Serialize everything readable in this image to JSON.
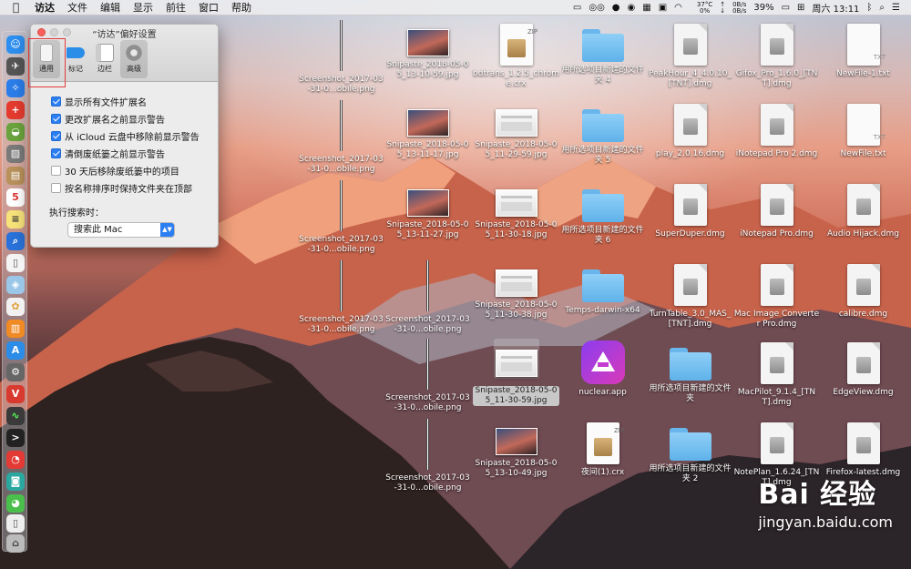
{
  "menubar": {
    "app_name": "访达",
    "items": [
      "文件",
      "编辑",
      "显示",
      "前往",
      "窗口",
      "帮助"
    ],
    "status": {
      "temp": "37°C",
      "temp_sub": "0%",
      "net_up": "0B/s",
      "net_down": "0B/s",
      "battery": "39%",
      "clock": "周六 13:11"
    }
  },
  "window": {
    "title": "“访达”偏好设置",
    "tabs": [
      {
        "label": "通用",
        "icon": "general-switch-icon",
        "active": true
      },
      {
        "label": "标记",
        "icon": "tag-icon",
        "active": false
      },
      {
        "label": "边栏",
        "icon": "sidebar-icon",
        "active": false
      },
      {
        "label": "高级",
        "icon": "gear-icon",
        "active": false
      }
    ],
    "options": [
      {
        "label": "显示所有文件扩展名",
        "checked": true
      },
      {
        "label": "更改扩展名之前显示警告",
        "checked": true
      },
      {
        "label": "从 iCloud 云盘中移除前显示警告",
        "checked": true
      },
      {
        "label": "清倒废纸篓之前显示警告",
        "checked": true
      },
      {
        "label": "30 天后移除废纸篓中的项目",
        "checked": false
      },
      {
        "label": "按名称排序时保持文件夹在顶部",
        "checked": false
      }
    ],
    "search_label": "执行搜索时：",
    "search_value": "搜索此 Mac"
  },
  "desktop": {
    "col1": [
      "Screenshot_2017-03-31-0...obile.png",
      "Screenshot_2017-03-31-0...obile.png",
      "Screenshot_2017-03-31-0...obile.png",
      "Screenshot_2017-03-31-0...obile.png"
    ],
    "col2": [
      "Snipaste_2018-05-05_13-10-59.jpg",
      "Snipaste_2018-05-05_13-11-17.jpg",
      "Snipaste_2018-05-05_13-11-27.jpg",
      "Screenshot_2017-03-31-0...obile.png",
      "Screenshot_2017-03-31-0...obile.png",
      "Screenshot_2017-03-31-0...obile.png"
    ],
    "col3": [
      "bdtrans_1.2.5_chrome.crx",
      "Snipaste_2018-05-05_11-29-59.jpg",
      "Snipaste_2018-05-05_11-30-18.jpg",
      "Snipaste_2018-05-05_11-30-38.jpg",
      "Snipaste_2018-05-05_11-30-59.jpg",
      "Snipaste_2018-05-05_13-10-49.jpg"
    ],
    "col4": [
      "用所选项目新建的文件夹 4",
      "用所选项目新建的文件夹 5",
      "用所选项目新建的文件夹 6",
      "Temps-darwin-x64",
      "nuclear.app",
      "夜间(1).crx"
    ],
    "col5": [
      "PeakHour_4_4.0.10_[TNT].dmg",
      "play_2.0.16.dmg",
      "SuperDuper.dmg",
      "TurnTable_3.0_MAS_[TNT].dmg",
      "用所选项目新建的文件夹",
      "用所选项目新建的文件夹 2"
    ],
    "col6": [
      "Gifox_Pro_1.6.0_[TNT].dmg",
      "iNotepad Pro 2.dmg",
      "iNotepad Pro.dmg",
      "Mac Image Converter Pro.dmg",
      "MacPilot_9.1.4_[TNT].dmg",
      "NotePlan_1.6.24_[TNT].dmg"
    ],
    "col7": [
      "NewFile-1.txt",
      "NewFile.txt",
      "Audio Hijack.dmg",
      "calibre.dmg",
      "EdgeView.dmg",
      "Firefox-latest.dmg"
    ],
    "txt_tag": "TXT",
    "zip_tag": "ZIP"
  },
  "watermark": {
    "line1": "Bai 经验",
    "line2": "jingyan.baidu.com"
  }
}
